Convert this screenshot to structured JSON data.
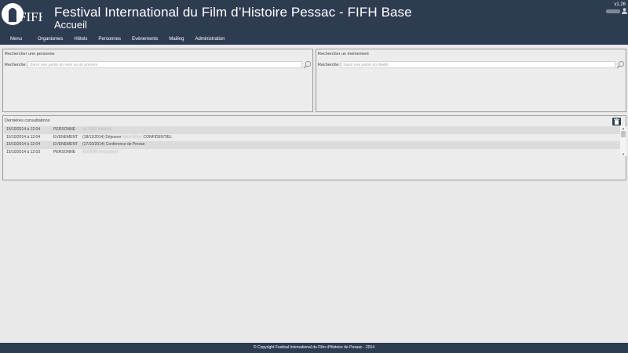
{
  "header": {
    "logo_text": "FIFHi",
    "app_title": "Festival International du Film d’Histoire Pessac - FIFH Base",
    "page_title": "Accueil",
    "version": "v1.26",
    "user_icon": "user-icon"
  },
  "nav": {
    "items": [
      {
        "label": "Menu"
      },
      {
        "label": "Organismes"
      },
      {
        "label": "Hôtels"
      },
      {
        "label": "Personnes"
      },
      {
        "label": "Evénements"
      },
      {
        "label": "Mailing"
      },
      {
        "label": "Administration"
      }
    ]
  },
  "search_person": {
    "title": "Rechercher une personne",
    "label": "Recherche :",
    "placeholder": "Saisir une partie du nom ou du prénom",
    "value": "",
    "button_icon": "search-icon"
  },
  "search_event": {
    "title": "Rechercher un événement",
    "label": "Recherche :",
    "placeholder": "Saisir une partie du libellé",
    "value": "",
    "button_icon": "search-icon"
  },
  "recent": {
    "title": "Dernières consultations",
    "clear_icon": "trash-icon",
    "rows": [
      {
        "date": "15/10/2014 à 12:04",
        "type": "PERSONNE",
        "prefix": "",
        "redacted": "LE ROY Danielle",
        "suffix": ""
      },
      {
        "date": "15/10/2014 à 12:04",
        "type": "EVENEMENT",
        "prefix": "(18/11/2014) Déjeuner ",
        "redacted": "Henri Brion",
        "suffix": " CONFIDENTIEL"
      },
      {
        "date": "15/10/2014 à 12:04",
        "type": "EVENEMENT",
        "prefix": "(17/10/2014) Conférence de Presse",
        "redacted": "",
        "suffix": ""
      },
      {
        "date": "15/10/2014 à 12:03",
        "type": "PERSONNE",
        "prefix": "",
        "redacted": "AUDRIN Jean-pierre",
        "suffix": ""
      }
    ]
  },
  "footer": {
    "text": "© Copyright Festival International du Film d'Histoire de Pessac - 2014"
  },
  "colors": {
    "header_bg": "#2e3c52",
    "page_bg": "#e9e9e9",
    "panel_border": "#9b9b9b",
    "row_alt": "#dcdcdc"
  }
}
